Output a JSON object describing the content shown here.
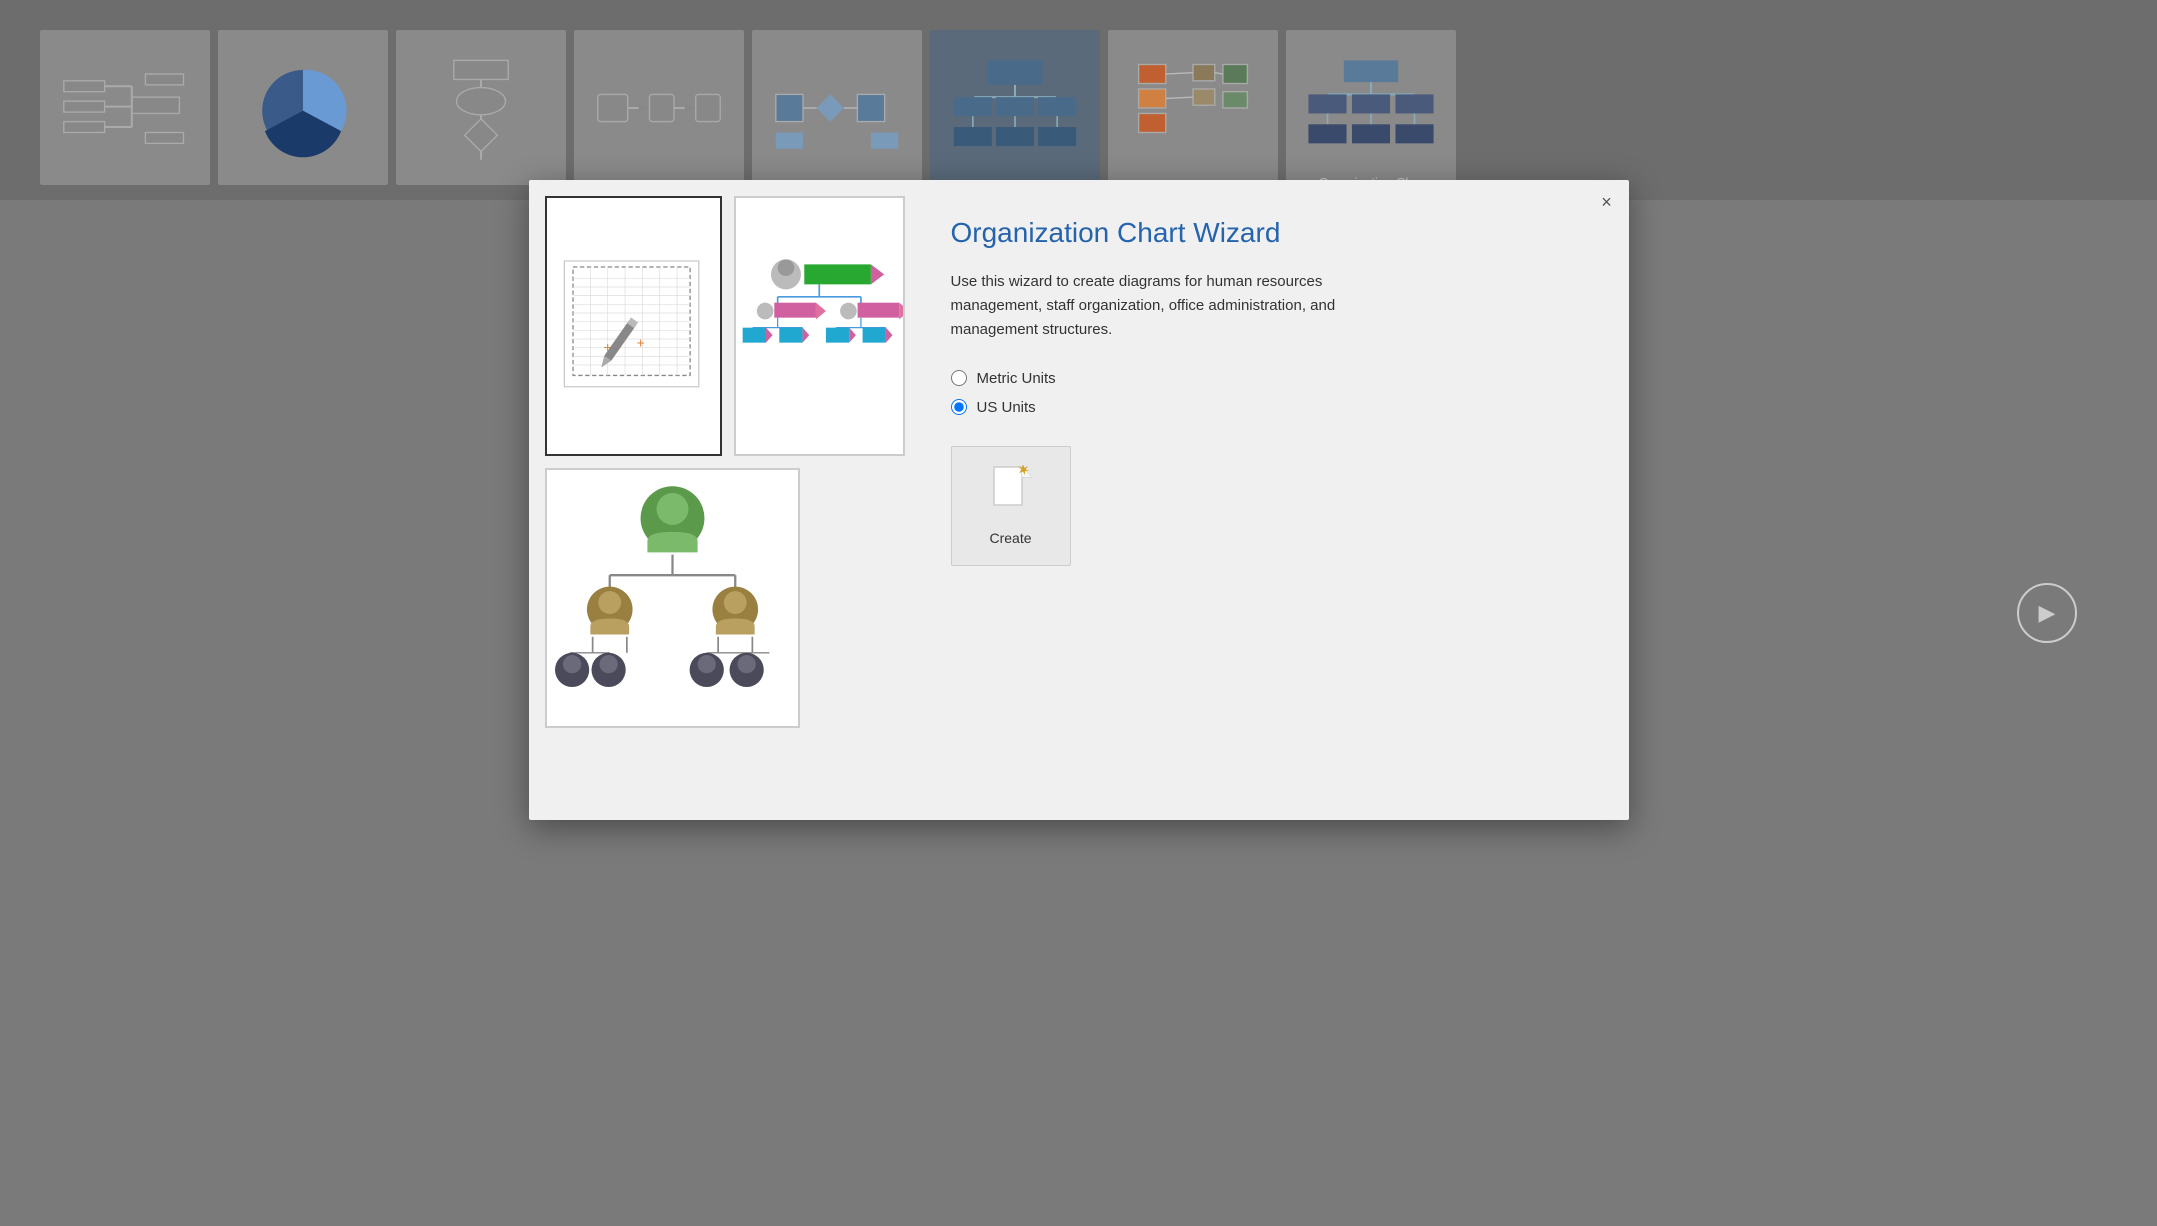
{
  "background": {
    "thumbnails": [
      {
        "id": "t1",
        "type": "network-diagram"
      },
      {
        "id": "t2",
        "type": "pie-chart"
      },
      {
        "id": "t3",
        "type": "flowchart"
      },
      {
        "id": "t4",
        "type": "process-flow"
      },
      {
        "id": "t5",
        "type": "data-flow"
      },
      {
        "id": "t6",
        "type": "org-chart-blue"
      },
      {
        "id": "t7",
        "type": "network-icons"
      },
      {
        "id": "t8",
        "type": "org-chart-boxes"
      }
    ],
    "labels": [
      "...",
      "Organization Ch..."
    ]
  },
  "dialog": {
    "title": "Organization Chart Wizard",
    "description": "Use this wizard to create diagrams for human resources management, staff organization, office administration, and management structures.",
    "close_label": "×",
    "units": {
      "metric_label": "Metric Units",
      "us_label": "US Units",
      "selected": "us"
    },
    "create_button_label": "Create"
  },
  "play_button": {
    "label": "▶"
  }
}
